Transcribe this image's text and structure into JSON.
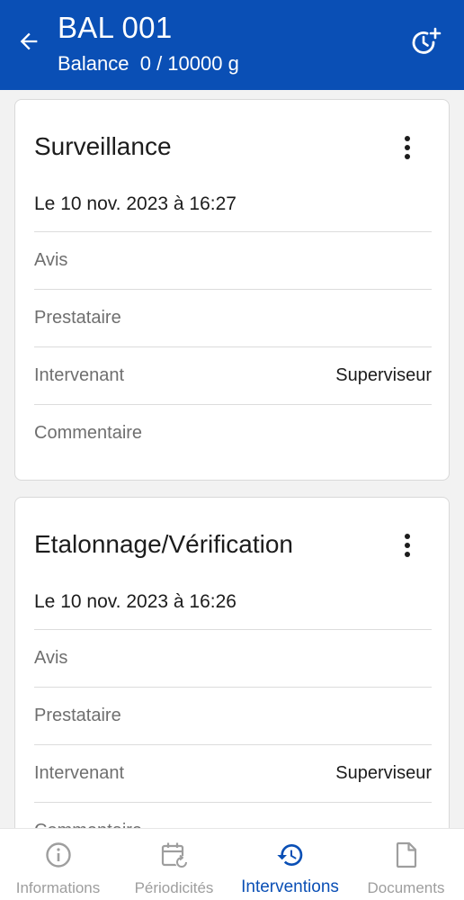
{
  "header": {
    "title": "BAL 001",
    "subtitle": "Balance  0 / 10000 g",
    "background_color": "#0a4fb5"
  },
  "cards": [
    {
      "title": "Surveillance",
      "date": "Le 10 nov. 2023 à 16:27",
      "rows": [
        {
          "label": "Avis",
          "value": ""
        },
        {
          "label": "Prestataire",
          "value": ""
        },
        {
          "label": "Intervenant",
          "value": "Superviseur"
        },
        {
          "label": "Commentaire",
          "value": ""
        }
      ]
    },
    {
      "title": "Etalonnage/Vérification",
      "date": "Le 10 nov. 2023 à 16:26",
      "rows": [
        {
          "label": "Avis",
          "value": ""
        },
        {
          "label": "Prestataire",
          "value": ""
        },
        {
          "label": "Intervenant",
          "value": "Superviseur"
        },
        {
          "label": "Commentaire",
          "value": ""
        }
      ]
    }
  ],
  "bottom_nav": {
    "items": [
      {
        "label": "Informations",
        "icon": "info-icon",
        "active": false
      },
      {
        "label": "Périodicités",
        "icon": "calendar-repeat-icon",
        "active": false
      },
      {
        "label": "Interventions",
        "icon": "history-icon",
        "active": true
      },
      {
        "label": "Documents",
        "icon": "document-icon",
        "active": false
      }
    ],
    "active_color": "#0a4fb5",
    "inactive_color": "#9e9e9e"
  }
}
